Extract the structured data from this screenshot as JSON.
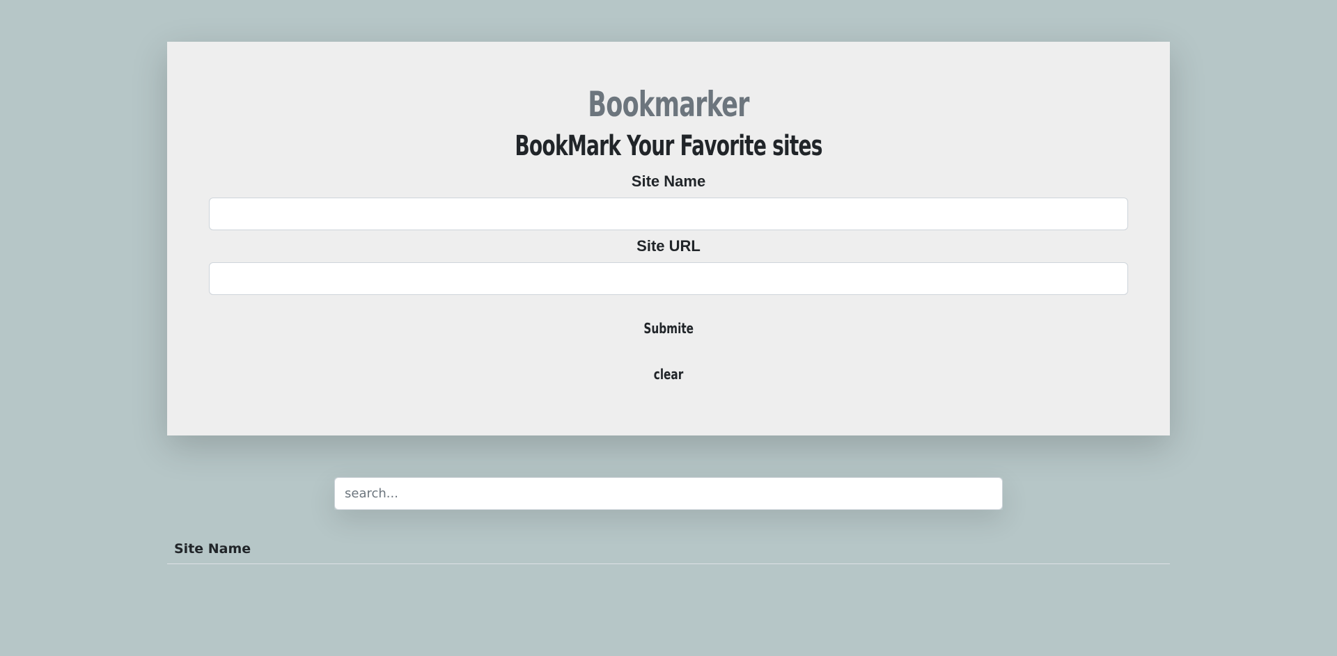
{
  "header": {
    "brand": "Bookmarker",
    "tagline": "BookMark Your Favorite sites"
  },
  "form": {
    "site_name_label": "Site Name",
    "site_name_value": "",
    "site_url_label": "Site URL",
    "site_url_value": "",
    "submit_label": "Submite",
    "clear_label": "clear"
  },
  "search": {
    "placeholder": "search...",
    "value": ""
  },
  "table": {
    "columns": [
      "Site Name"
    ],
    "rows": []
  },
  "colors": {
    "page_background": "#b6c6c7",
    "card_background": "#eeeeee",
    "brand_text": "#6c757d",
    "primary_text": "#212529"
  }
}
